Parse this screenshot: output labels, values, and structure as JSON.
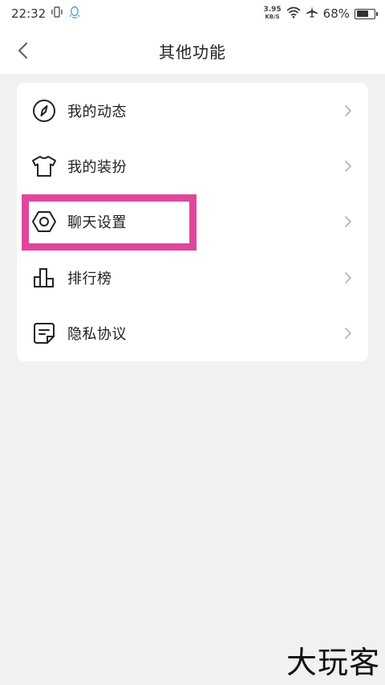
{
  "status_bar": {
    "time": "22:32",
    "net_speed_value": "3.95",
    "net_speed_unit": "KB/S",
    "battery_percent": "68%",
    "battery_level": 0.68
  },
  "header": {
    "title": "其他功能"
  },
  "menu": {
    "items": [
      {
        "label": "我的动态",
        "icon": "compass-icon"
      },
      {
        "label": "我的装扮",
        "icon": "tshirt-icon"
      },
      {
        "label": "聊天设置",
        "icon": "hexagon-settings-icon"
      },
      {
        "label": "排行榜",
        "icon": "bar-chart-icon"
      },
      {
        "label": "隐私协议",
        "icon": "document-icon"
      }
    ]
  },
  "annotation": {
    "highlight_color": "#e0479b",
    "highlighted_item": "聊天设置"
  },
  "watermark": {
    "text": "大玩客"
  },
  "colors": {
    "background": "#f1f1f1",
    "card": "#ffffff",
    "text": "#222222",
    "chevron": "#b5b5b5"
  }
}
